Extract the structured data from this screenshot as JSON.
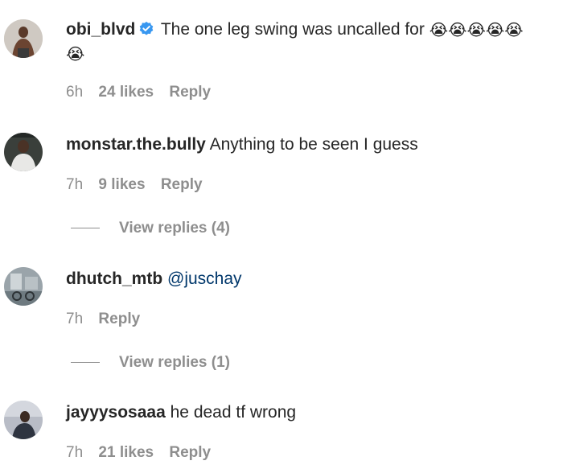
{
  "comments": [
    {
      "username": "obi_blvd",
      "verified": true,
      "text": "The one leg swing was uncalled for",
      "emojis": [
        "😭",
        "😭",
        "😭",
        "😭",
        "😭",
        "😭"
      ],
      "time": "6h",
      "likes": "24 likes",
      "reply": "Reply"
    },
    {
      "username": "monstar.the.bully",
      "text": "Anything to be seen I guess",
      "time": "7h",
      "likes": "9 likes",
      "reply": "Reply",
      "view_replies": "View replies (4)"
    },
    {
      "username": "dhutch_mtb",
      "mention": "@juschay",
      "time": "7h",
      "reply": "Reply",
      "view_replies": "View replies (1)"
    },
    {
      "username": "jayyysosaaa",
      "text": "he dead tf wrong",
      "time": "7h",
      "likes": "21 likes",
      "reply": "Reply"
    }
  ],
  "colors": {
    "text": "#262626",
    "secondary": "#8e8e8e",
    "mention": "#00376b",
    "verified": "#3897f0"
  },
  "icons": [
    "verified-badge-icon",
    "loudly-crying-face-emoji"
  ]
}
